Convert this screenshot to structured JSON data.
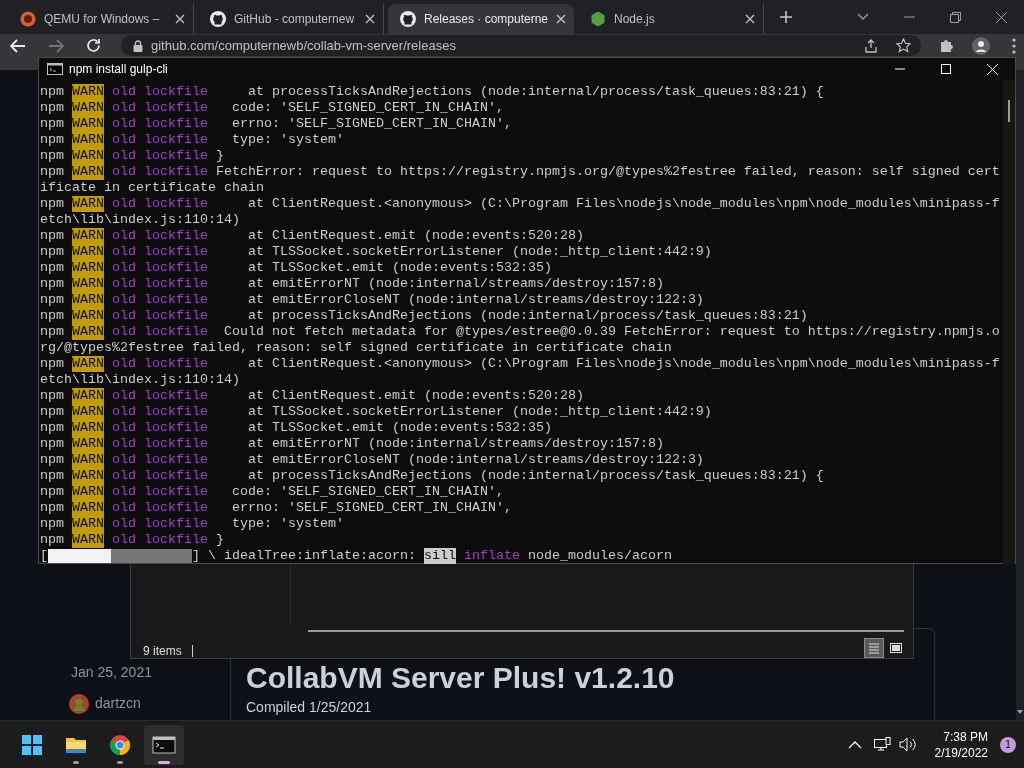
{
  "browser": {
    "tabs": [
      {
        "kind": "qemu",
        "title": "QEMU for Windows –",
        "selected": false
      },
      {
        "kind": "github",
        "title": "GitHub - computernew",
        "selected": false
      },
      {
        "kind": "github",
        "title": "Releases · computerne",
        "selected": true
      },
      {
        "kind": "node",
        "title": "Node.js",
        "selected": false
      }
    ],
    "address": "github.com/computernewb/collab-vm-server/releases"
  },
  "release": {
    "date": "Jan 25, 2021",
    "author": "dartzcn",
    "title": "CollabVM Server Plus! v1.2.10",
    "body": "Compiled 1/25/2021"
  },
  "explorer": {
    "status": "9 items",
    "views": [
      {
        "kind": "details",
        "selected": true
      },
      {
        "kind": "tiles",
        "selected": false
      }
    ]
  },
  "terminal": {
    "title": "npm install gulp-cli",
    "lines": [
      {
        "kind": "warn",
        "prefix": "npm",
        "level": "WARN",
        "scope": "old lockfile",
        "text": "     at processTicksAndRejections (node:internal/process/task_queues:83:21) {"
      },
      {
        "kind": "warn",
        "prefix": "npm",
        "level": "WARN",
        "scope": "old lockfile",
        "text": "   code: 'SELF_SIGNED_CERT_IN_CHAIN',"
      },
      {
        "kind": "warn",
        "prefix": "npm",
        "level": "WARN",
        "scope": "old lockfile",
        "text": "   errno: 'SELF_SIGNED_CERT_IN_CHAIN',"
      },
      {
        "kind": "warn",
        "prefix": "npm",
        "level": "WARN",
        "scope": "old lockfile",
        "text": "   type: 'system'"
      },
      {
        "kind": "warn",
        "prefix": "npm",
        "level": "WARN",
        "scope": "old lockfile",
        "text": " }"
      },
      {
        "kind": "warn",
        "prefix": "npm",
        "level": "WARN",
        "scope": "old lockfile",
        "text": " FetchError: request to https://registry.npmjs.org/@types%2festree failed, reason: self signed cert"
      },
      {
        "kind": "plain",
        "text": "ificate in certificate chain"
      },
      {
        "kind": "warn",
        "prefix": "npm",
        "level": "WARN",
        "scope": "old lockfile",
        "text": "     at ClientRequest.<anonymous> (C:\\Program Files\\nodejs\\node_modules\\npm\\node_modules\\minipass-f"
      },
      {
        "kind": "plain",
        "text": "etch\\lib\\index.js:110:14)"
      },
      {
        "kind": "warn",
        "prefix": "npm",
        "level": "WARN",
        "scope": "old lockfile",
        "text": "     at ClientRequest.emit (node:events:520:28)"
      },
      {
        "kind": "warn",
        "prefix": "npm",
        "level": "WARN",
        "scope": "old lockfile",
        "text": "     at TLSSocket.socketErrorListener (node:_http_client:442:9)"
      },
      {
        "kind": "warn",
        "prefix": "npm",
        "level": "WARN",
        "scope": "old lockfile",
        "text": "     at TLSSocket.emit (node:events:532:35)"
      },
      {
        "kind": "warn",
        "prefix": "npm",
        "level": "WARN",
        "scope": "old lockfile",
        "text": "     at emitErrorNT (node:internal/streams/destroy:157:8)"
      },
      {
        "kind": "warn",
        "prefix": "npm",
        "level": "WARN",
        "scope": "old lockfile",
        "text": "     at emitErrorCloseNT (node:internal/streams/destroy:122:3)"
      },
      {
        "kind": "warn",
        "prefix": "npm",
        "level": "WARN",
        "scope": "old lockfile",
        "text": "     at processTicksAndRejections (node:internal/process/task_queues:83:21)"
      },
      {
        "kind": "warn",
        "prefix": "npm",
        "level": "WARN",
        "scope": "old lockfile",
        "text": "  Could not fetch metadata for @types/estree@0.0.39 FetchError: request to https://registry.npmjs.o"
      },
      {
        "kind": "plain",
        "text": "rg/@types%2festree failed, reason: self signed certificate in certificate chain"
      },
      {
        "kind": "warn",
        "prefix": "npm",
        "level": "WARN",
        "scope": "old lockfile",
        "text": "     at ClientRequest.<anonymous> (C:\\Program Files\\nodejs\\node_modules\\npm\\node_modules\\minipass-f"
      },
      {
        "kind": "plain",
        "text": "etch\\lib\\index.js:110:14)"
      },
      {
        "kind": "warn",
        "prefix": "npm",
        "level": "WARN",
        "scope": "old lockfile",
        "text": "     at ClientRequest.emit (node:events:520:28)"
      },
      {
        "kind": "warn",
        "prefix": "npm",
        "level": "WARN",
        "scope": "old lockfile",
        "text": "     at TLSSocket.socketErrorListener (node:_http_client:442:9)"
      },
      {
        "kind": "warn",
        "prefix": "npm",
        "level": "WARN",
        "scope": "old lockfile",
        "text": "     at TLSSocket.emit (node:events:532:35)"
      },
      {
        "kind": "warn",
        "prefix": "npm",
        "level": "WARN",
        "scope": "old lockfile",
        "text": "     at emitErrorNT (node:internal/streams/destroy:157:8)"
      },
      {
        "kind": "warn",
        "prefix": "npm",
        "level": "WARN",
        "scope": "old lockfile",
        "text": "     at emitErrorCloseNT (node:internal/streams/destroy:122:3)"
      },
      {
        "kind": "warn",
        "prefix": "npm",
        "level": "WARN",
        "scope": "old lockfile",
        "text": "     at processTicksAndRejections (node:internal/process/task_queues:83:21) {"
      },
      {
        "kind": "warn",
        "prefix": "npm",
        "level": "WARN",
        "scope": "old lockfile",
        "text": "   code: 'SELF_SIGNED_CERT_IN_CHAIN',"
      },
      {
        "kind": "warn",
        "prefix": "npm",
        "level": "WARN",
        "scope": "old lockfile",
        "text": "   errno: 'SELF_SIGNED_CERT_IN_CHAIN',"
      },
      {
        "kind": "warn",
        "prefix": "npm",
        "level": "WARN",
        "scope": "old lockfile",
        "text": "   type: 'system'"
      },
      {
        "kind": "warn",
        "prefix": "npm",
        "level": "WARN",
        "scope": "old lockfile",
        "text": " }"
      }
    ],
    "progress": {
      "open": "[",
      "level": 0.44,
      "close": "]",
      "text": "\\ idealTree:inflate:acorn:",
      "tag": "sill",
      "verb": "inflate",
      "path": "node_modules/acorn"
    }
  },
  "taskbar": {
    "apps": [
      {
        "kind": "start",
        "running": false,
        "selected": false
      },
      {
        "kind": "explorer",
        "running": true,
        "selected": false
      },
      {
        "kind": "chrome",
        "running": true,
        "selected": false
      },
      {
        "kind": "terminal",
        "running": true,
        "selected": true
      }
    ],
    "time": "7:38 PM",
    "date": "2/19/2022",
    "notifications": "1"
  }
}
